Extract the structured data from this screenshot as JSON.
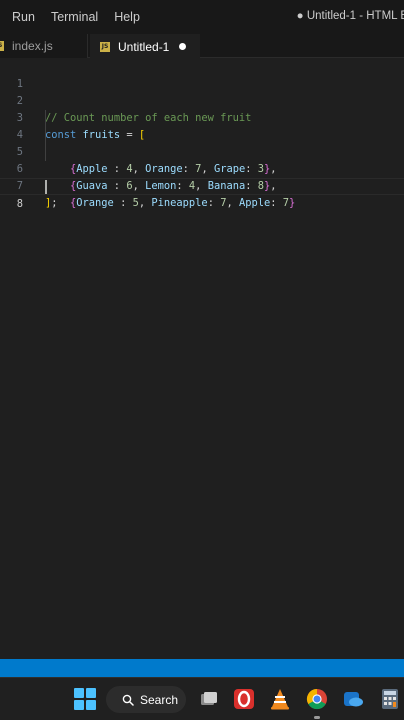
{
  "menubar": {
    "items": [
      "Run",
      "Terminal",
      "Help"
    ],
    "window_title": "● Untitled-1 - HTML E"
  },
  "tabs": [
    {
      "label": "index.js",
      "icon": "js-file-icon",
      "active": false
    },
    {
      "label": "Untitled-1",
      "icon": "js-file-icon",
      "active": true,
      "dirty": true
    }
  ],
  "editor": {
    "line_numbers": [
      "1",
      "2",
      "3",
      "4",
      "5",
      "6",
      "7",
      "8"
    ],
    "current_line": 8,
    "code": {
      "comment": "// Count number of each new fruit",
      "decl_kw": "const",
      "decl_name": "fruits",
      "decl_eq": " = ",
      "open_bracket": "[",
      "rows": [
        {
          "fields": [
            {
              "key": "Apple",
              "sep": " : ",
              "value": "4"
            },
            {
              "key": "Orange",
              "sep": ": ",
              "value": "7"
            },
            {
              "key": "Grape",
              "sep": ": ",
              "value": "3"
            }
          ],
          "trail": ","
        },
        {
          "fields": [
            {
              "key": "Guava",
              "sep": " : ",
              "value": "6"
            },
            {
              "key": "Lemon",
              "sep": ": ",
              "value": "4"
            },
            {
              "key": "Banana",
              "sep": ": ",
              "value": "8"
            }
          ],
          "trail": ","
        },
        {
          "fields": [
            {
              "key": "Orange",
              "sep": " : ",
              "value": "5"
            },
            {
              "key": "Pineapple",
              "sep": ": ",
              "value": "7"
            },
            {
              "key": "Apple",
              "sep": ": ",
              "value": "7"
            }
          ],
          "trail": ""
        }
      ],
      "close_bracket": "]",
      "close_semi": ";"
    }
  },
  "colors": {
    "accent_statusbar": "#007acc",
    "comment": "#6a9955",
    "keyword": "#569cd6",
    "bracket_outer": "#ffd700",
    "bracket_inner": "#da70d6",
    "number": "#b5cea8"
  },
  "taskbar": {
    "search_label": "Search",
    "apps": [
      "windows-start-icon",
      "search-icon",
      "task-view-icon",
      "opera-icon",
      "vlc-icon",
      "chrome-icon",
      "onedrive-icon",
      "calculator-icon"
    ]
  }
}
